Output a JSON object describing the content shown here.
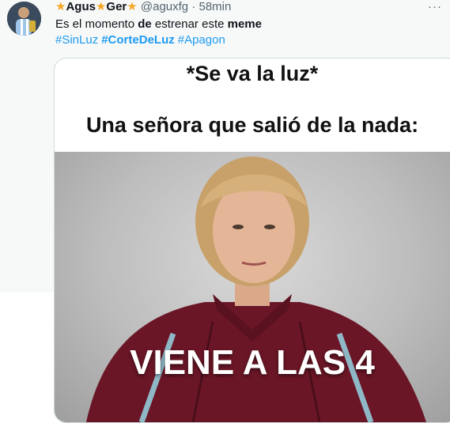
{
  "tweet": {
    "star_glyph": "★",
    "name_part1": "Agus",
    "name_part2": "Ger",
    "handle": "@aguxfg",
    "separator": "·",
    "time": "58min",
    "more_label": "···",
    "text_pre": "Es el momento ",
    "text_bold1": "de",
    "text_mid": " estrenar este ",
    "text_bold2": "meme",
    "hashtags": [
      "#SinLuz",
      "#CorteDeLuz",
      "#Apagon"
    ]
  },
  "meme": {
    "line1": "*Se va la luz*",
    "line2": "Una señora que salió de la nada:",
    "caption": "VIENE A LAS 4"
  },
  "colors": {
    "link": "#1d9bf0",
    "secondary_text": "#536471",
    "star": "#f5a623",
    "jacket": "#6b1626"
  }
}
